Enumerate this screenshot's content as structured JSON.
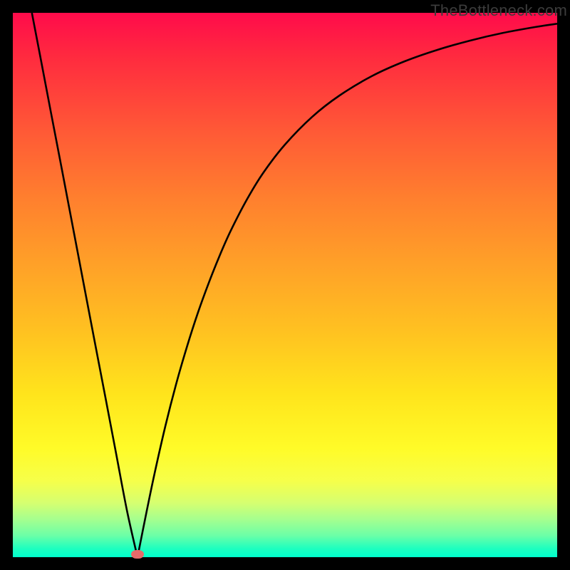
{
  "watermark": "TheBottleneck.com",
  "chart_data": {
    "type": "line",
    "title": "",
    "xlabel": "",
    "ylabel": "",
    "xlim": [
      0,
      100
    ],
    "ylim": [
      0,
      100
    ],
    "x": [
      3.5,
      5,
      7,
      9,
      11,
      13,
      15,
      17,
      19,
      21,
      22.9,
      24.5,
      26,
      28,
      30,
      32,
      34,
      36,
      38,
      40,
      43,
      46,
      50,
      55,
      60,
      66,
      72,
      78,
      84,
      90,
      96,
      100
    ],
    "y": [
      100,
      92.2,
      81.7,
      71.3,
      60.8,
      50.3,
      39.8,
      29.4,
      18.9,
      8.4,
      0,
      8.0,
      15.2,
      24.0,
      31.8,
      38.7,
      44.9,
      50.4,
      55.4,
      59.9,
      65.7,
      70.6,
      75.8,
      80.9,
      84.8,
      88.4,
      91.1,
      93.2,
      94.9,
      96.3,
      97.4,
      98.0
    ],
    "marker": {
      "x": 22.9,
      "y": 0
    },
    "colors": {
      "curve": "#000000",
      "marker": "#e66a6a",
      "gradient_top": "#ff0b4b",
      "gradient_bottom": "#00ffcc"
    }
  }
}
